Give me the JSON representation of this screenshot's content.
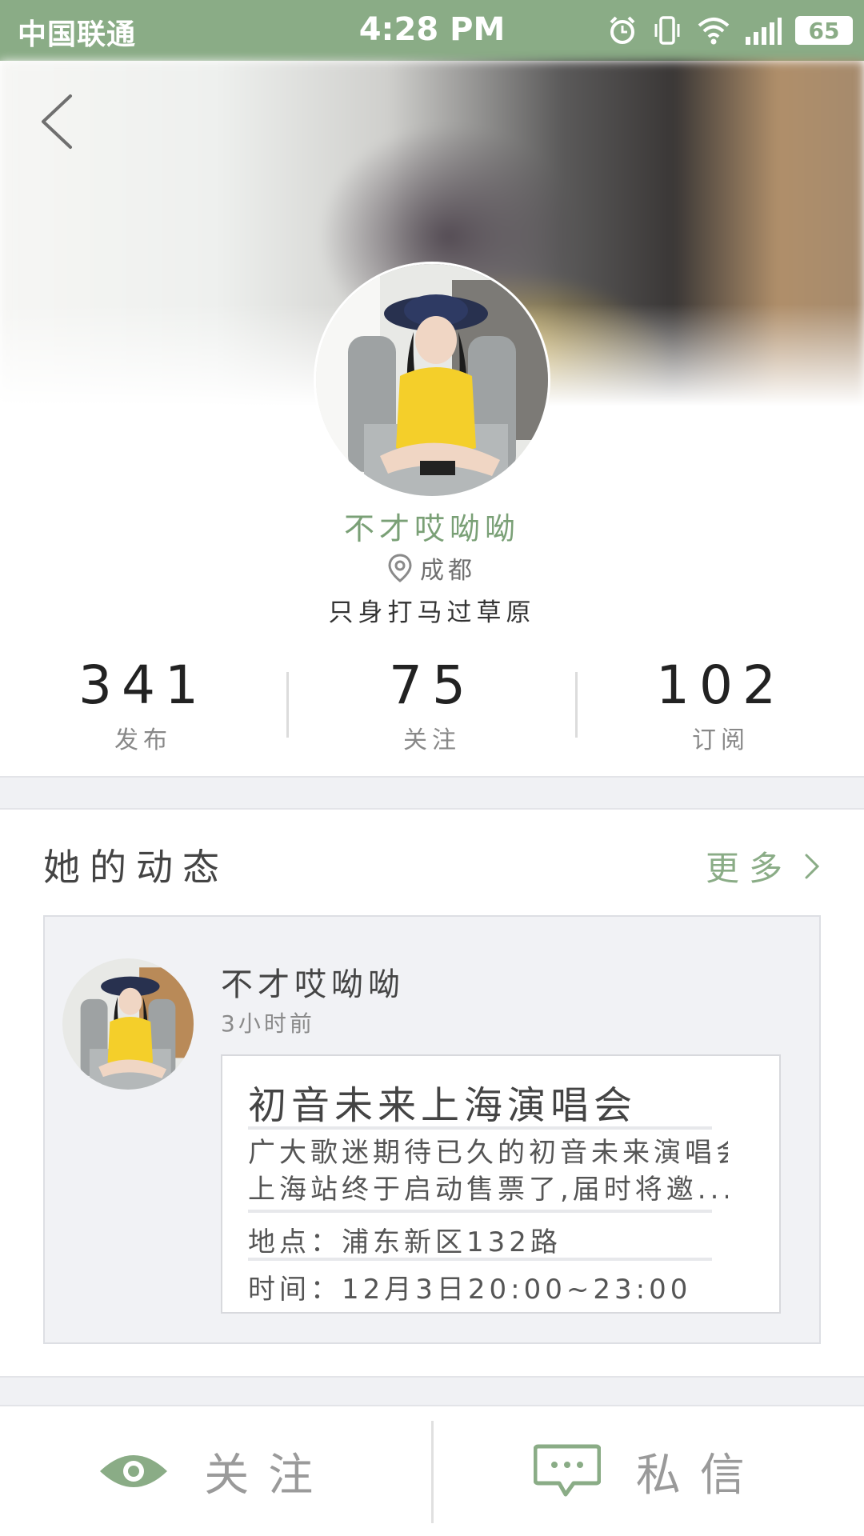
{
  "status_bar": {
    "carrier": "中国联通",
    "time": "4:28 PM",
    "battery": "65",
    "icons": [
      "alarm-icon",
      "vibrate-icon",
      "wifi-icon",
      "signal-icon",
      "battery-icon"
    ]
  },
  "colors": {
    "accent": "#8aac86",
    "name_green": "#7aa076"
  },
  "profile": {
    "name": "不才哎呦呦",
    "location": "成都",
    "bio": "只身打马过草原"
  },
  "stats": [
    {
      "value": "341",
      "label": "发布"
    },
    {
      "value": "75",
      "label": "关注"
    },
    {
      "value": "102",
      "label": "订阅"
    }
  ],
  "feed": {
    "title": "她的动态",
    "more": "更多",
    "post": {
      "user": "不才哎呦呦",
      "time": "3小时前",
      "event_title": "初音未来上海演唱会",
      "event_desc_1": "广大歌迷期待已久的初音未来演唱会",
      "event_desc_2": "上海站终于启动售票了,届时将邀...",
      "event_place": "地点：浦东新区132路",
      "event_time": "时间：12月3日20:00~23:00"
    }
  },
  "bottom_bar": {
    "follow": "关注",
    "message": "私信"
  }
}
